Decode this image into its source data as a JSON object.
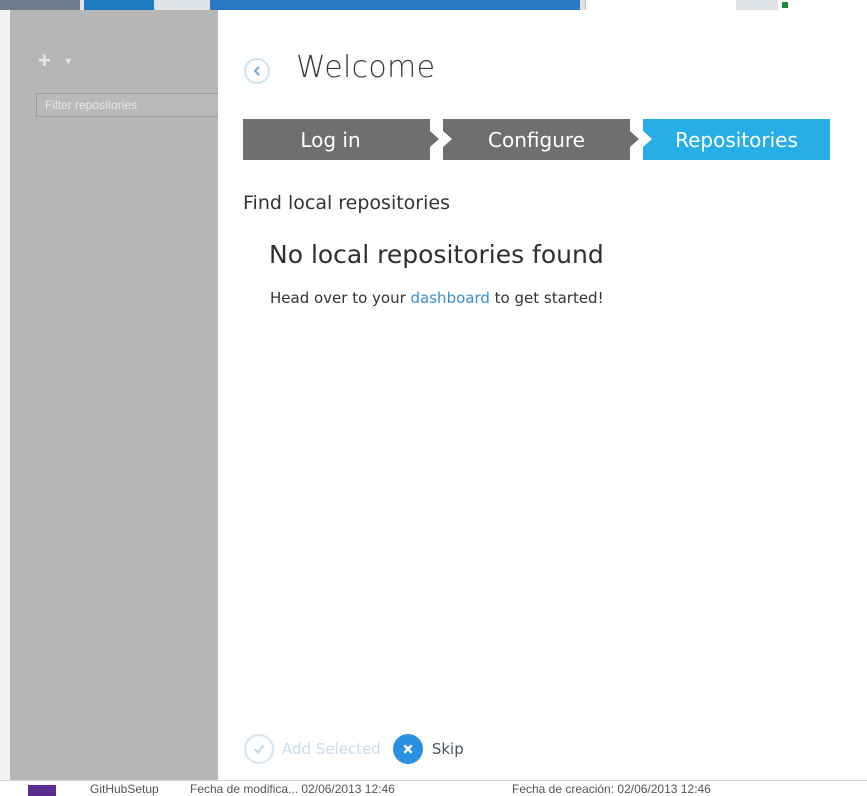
{
  "sidebar": {
    "filter_placeholder": "Filter repositories"
  },
  "dialog": {
    "title": "Welcome",
    "steps": [
      {
        "label": "Log in",
        "state": "done"
      },
      {
        "label": "Configure",
        "state": "done"
      },
      {
        "label": "Repositories",
        "state": "active"
      }
    ],
    "section_heading": "Find local repositories",
    "empty_title": "No local repositories found",
    "empty_sub_before": "Head over to your ",
    "empty_sub_link": "dashboard",
    "empty_sub_after": " to get started!",
    "footer": {
      "add_selected_label": "Add Selected",
      "skip_label": "Skip"
    }
  },
  "background": {
    "bottom_texts": [
      "GitHubSetup",
      "Fecha de modifica... 02/06/2013 12:46",
      "Fecha de creación: 02/06/2013 12:46"
    ]
  },
  "colors": {
    "accent": "#27aee6",
    "step_inactive": "#6f6f6f",
    "link": "#3b8fd0",
    "sidebar_bg": "#b6b6b6"
  }
}
